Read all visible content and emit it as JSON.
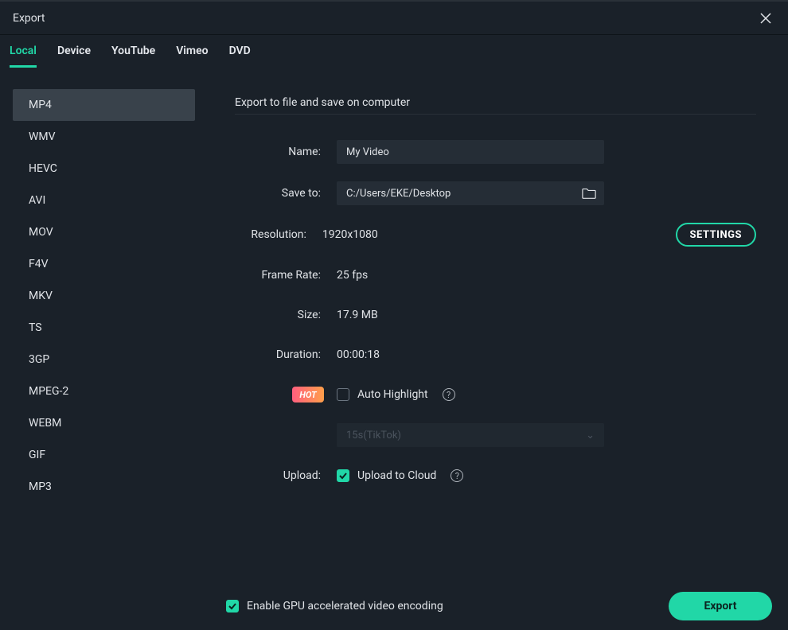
{
  "window": {
    "title": "Export"
  },
  "tabs": {
    "local": "Local",
    "device": "Device",
    "youtube": "YouTube",
    "vimeo": "Vimeo",
    "dvd": "DVD"
  },
  "formats": {
    "mp4": "MP4",
    "wmv": "WMV",
    "hevc": "HEVC",
    "avi": "AVI",
    "mov": "MOV",
    "f4v": "F4V",
    "mkv": "MKV",
    "ts": "TS",
    "gp3": "3GP",
    "mpeg2": "MPEG-2",
    "webm": "WEBM",
    "gif": "GIF",
    "mp3": "MP3"
  },
  "main": {
    "subtitle": "Export to file and save on computer",
    "labels": {
      "name": "Name:",
      "saveto": "Save to:",
      "resolution": "Resolution:",
      "framerate": "Frame Rate:",
      "size": "Size:",
      "duration": "Duration:",
      "upload": "Upload:"
    },
    "values": {
      "name": "My Video",
      "saveto": "C:/Users/EKE/Desktop",
      "resolution": "1920x1080",
      "framerate": "25 fps",
      "size": "17.9 MB",
      "duration": "00:00:18"
    },
    "settings_btn": "SETTINGS",
    "hot_badge": "HOT",
    "auto_highlight": "Auto Highlight",
    "preset_select": "15s(TikTok)",
    "upload_cloud": "Upload to Cloud"
  },
  "footer": {
    "gpu_label": "Enable GPU accelerated video encoding",
    "export_btn": "Export"
  }
}
